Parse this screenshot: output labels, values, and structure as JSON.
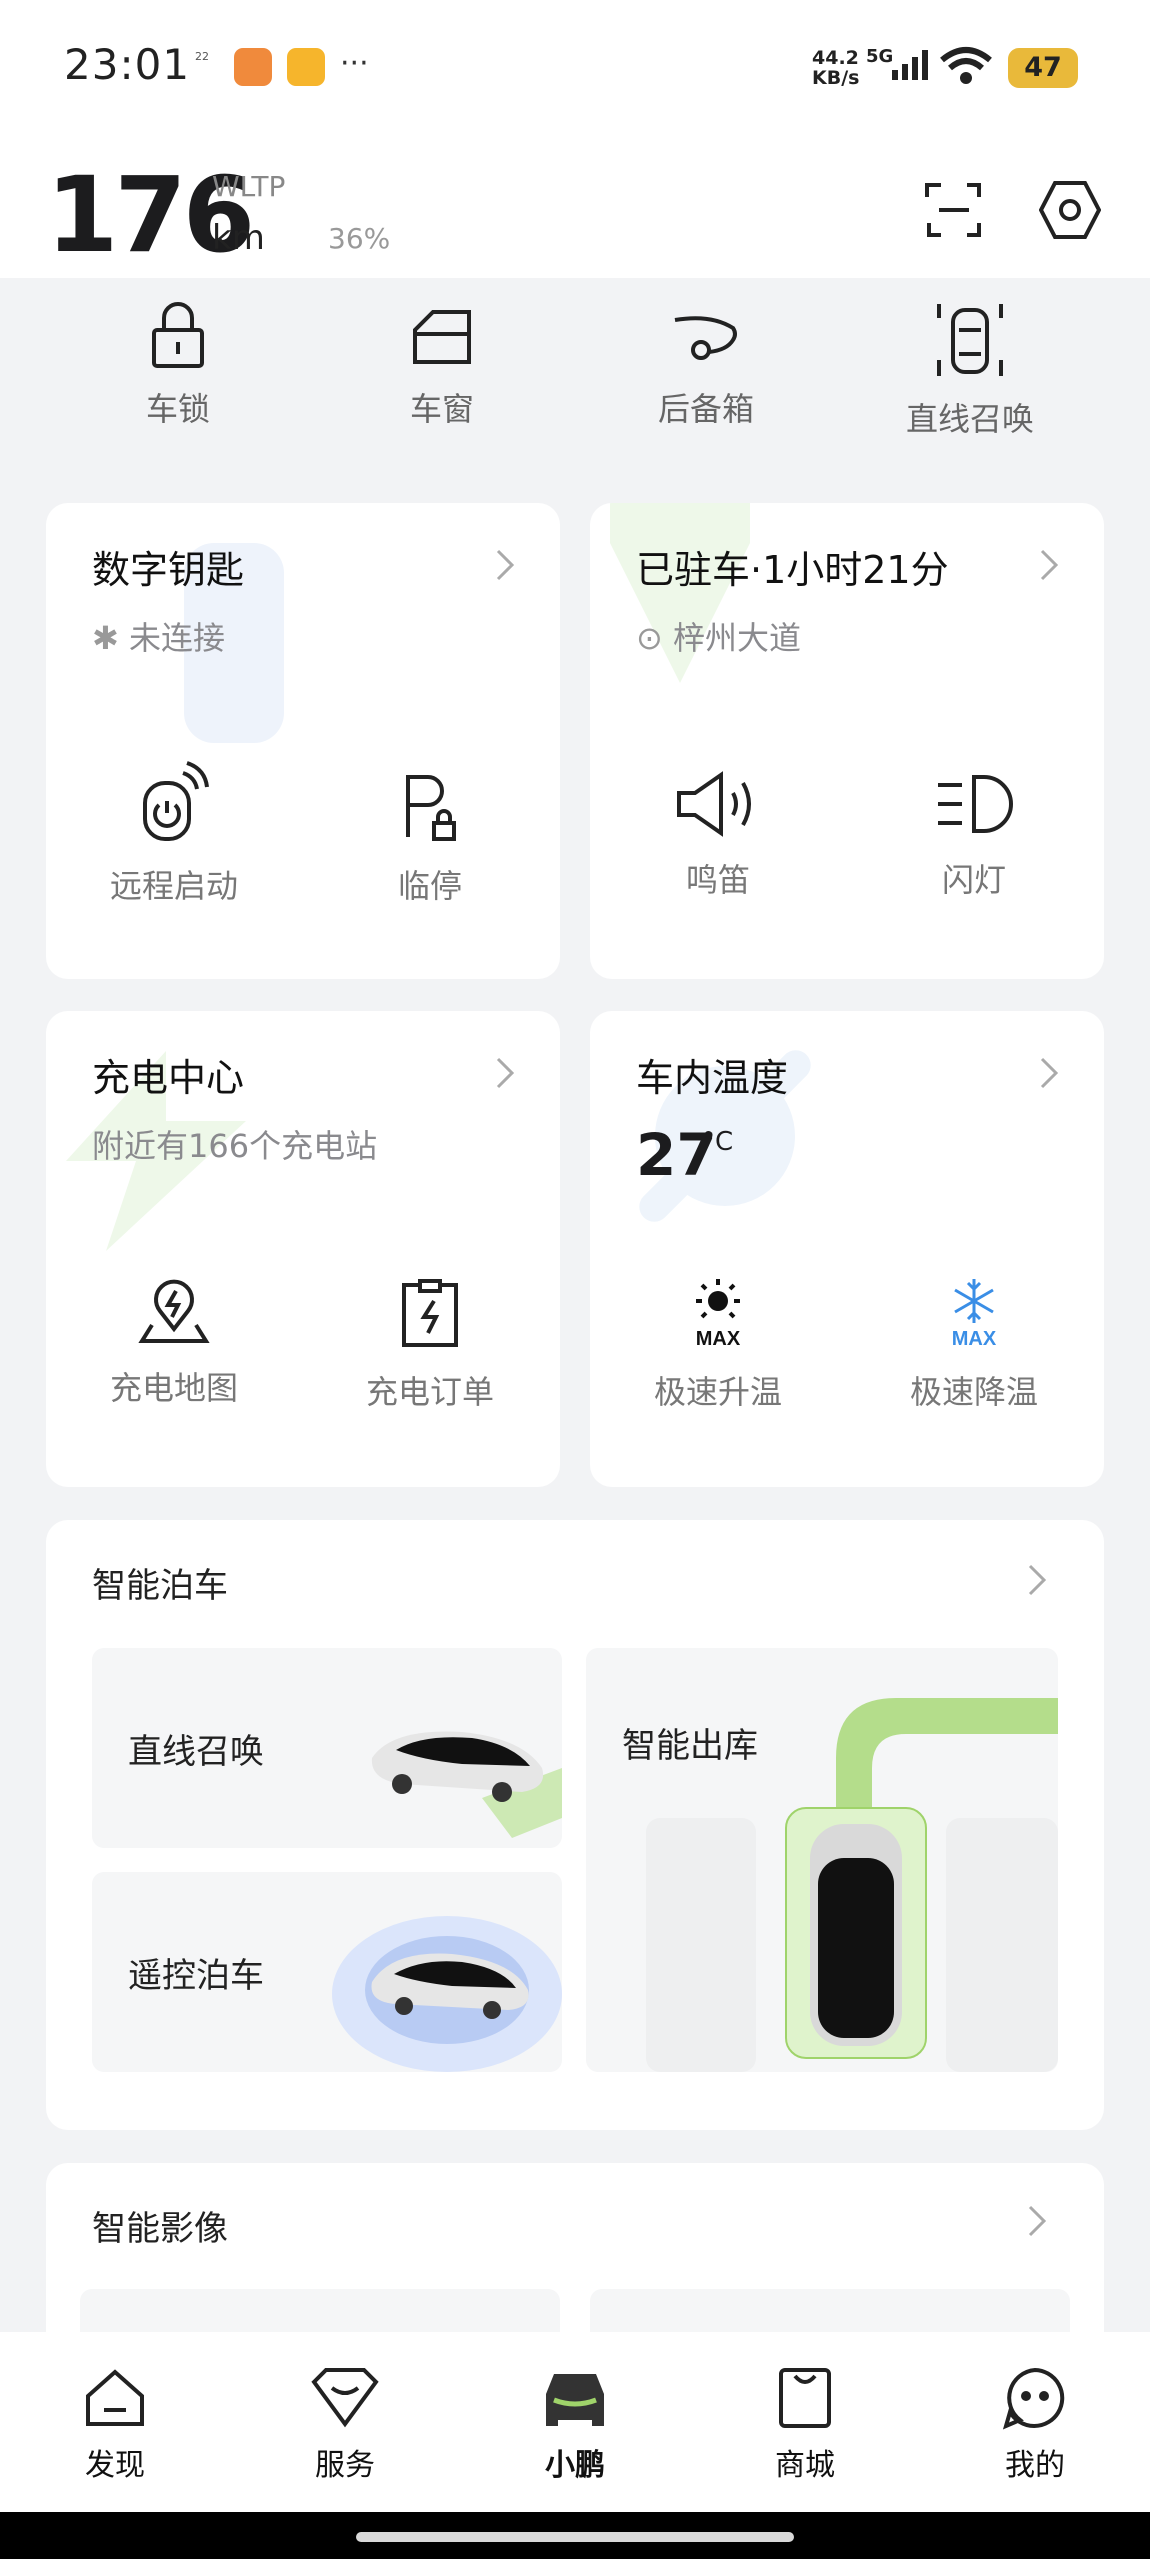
{
  "status_bar": {
    "time": "23:01",
    "date_label": "22",
    "more": "···",
    "net_speed": "44.2",
    "net_unit": "KB/s",
    "network": "5G",
    "battery": "47"
  },
  "header": {
    "range_value": "176",
    "range_standard": "WLTP",
    "range_unit": "km",
    "battery_percent": "36%"
  },
  "quick_actions": [
    {
      "label": "车锁",
      "icon": "lock-icon"
    },
    {
      "label": "车窗",
      "icon": "window-icon"
    },
    {
      "label": "后备箱",
      "icon": "trunk-icon"
    },
    {
      "label": "直线召唤",
      "icon": "summon-icon"
    }
  ],
  "digital_key": {
    "title": "数字钥匙",
    "status": "未连接",
    "actions": [
      {
        "label": "远程启动",
        "icon": "remote-start-icon"
      },
      {
        "label": "临停",
        "icon": "temp-parking-icon"
      }
    ]
  },
  "parking": {
    "title": "已驻车·1小时21分",
    "location": "梓州大道",
    "actions": [
      {
        "label": "鸣笛",
        "icon": "horn-icon"
      },
      {
        "label": "闪灯",
        "icon": "flash-lights-icon"
      }
    ]
  },
  "charging": {
    "title": "充电中心",
    "subtitle": "附近有166个充电站",
    "actions": [
      {
        "label": "充电地图",
        "icon": "charging-map-icon"
      },
      {
        "label": "充电订单",
        "icon": "charging-order-icon"
      }
    ]
  },
  "climate": {
    "title": "车内温度",
    "temperature": "27",
    "unit": "°C",
    "actions": [
      {
        "label": "极速升温",
        "icon": "max-heat-icon"
      },
      {
        "label": "极速降温",
        "icon": "max-cool-icon"
      }
    ],
    "max_text": "MAX"
  },
  "smart_parking": {
    "title": "智能泊车",
    "tiles": [
      {
        "label": "直线召唤"
      },
      {
        "label": "遥控泊车"
      },
      {
        "label": "智能出库"
      }
    ]
  },
  "smart_camera": {
    "title": "智能影像"
  },
  "bottom_nav": [
    {
      "label": "发现",
      "icon": "discover-icon"
    },
    {
      "label": "服务",
      "icon": "service-icon"
    },
    {
      "label": "小鹏",
      "icon": "car-icon"
    },
    {
      "label": "商城",
      "icon": "shop-icon"
    },
    {
      "label": "我的",
      "icon": "profile-icon"
    }
  ],
  "colors": {
    "accent_green": "#9fd36a",
    "cool_blue": "#3a8ee6",
    "card_bg": "#ffffff",
    "page_bg": "#f2f3f5"
  }
}
